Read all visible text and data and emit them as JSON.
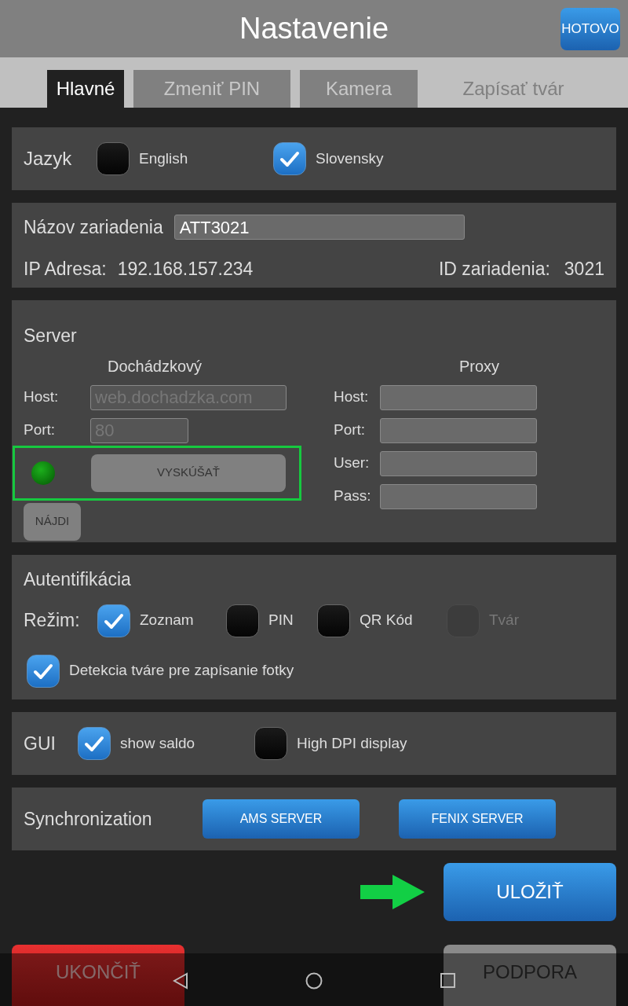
{
  "header": {
    "title": "Nastavenie",
    "done_button": "HOTOVO"
  },
  "tabs": [
    {
      "label": "Hlavné",
      "selected": true,
      "disabled": false
    },
    {
      "label": "Zmeniť PIN",
      "selected": false,
      "disabled": false
    },
    {
      "label": "Kamera",
      "selected": false,
      "disabled": false
    },
    {
      "label": "Zapísať tvár",
      "selected": false,
      "disabled": true
    }
  ],
  "language": {
    "label": "Jazyk",
    "options": [
      {
        "label": "English",
        "checked": false
      },
      {
        "label": "Slovensky",
        "checked": true
      }
    ]
  },
  "device": {
    "name_label": "Názov zariadenia",
    "name_value": "ATT3021",
    "ip_label": "IP Adresa:",
    "ip_value": "192.168.157.234",
    "id_label": "ID zariadenia:",
    "id_value": "3021"
  },
  "server": {
    "title": "Server",
    "attendance": {
      "heading": "Dochádzkový",
      "fields": [
        {
          "label": "Host:",
          "value": "web.dochadzka.com",
          "disabled": true
        },
        {
          "label": "Port:",
          "value": "80",
          "disabled": true
        }
      ],
      "status_on": true,
      "test_button": "VYSKÚŠAŤ",
      "find_button": "NÁJDI"
    },
    "proxy": {
      "heading": "Proxy",
      "fields": [
        {
          "label": "Host:"
        },
        {
          "label": "Port:"
        },
        {
          "label": "User:"
        },
        {
          "label": "Pass:"
        }
      ]
    }
  },
  "auth": {
    "title": "Autentifikácia",
    "mode_label": "Režim:",
    "modes": [
      {
        "label": "Zoznam",
        "checked": true,
        "disabled": false
      },
      {
        "label": "PIN",
        "checked": false,
        "disabled": false
      },
      {
        "label": "QR Kód",
        "checked": false,
        "disabled": false
      },
      {
        "label": "Tvár",
        "checked": false,
        "disabled": true
      }
    ],
    "face_detection": {
      "label": "Detekcia tváre pre zapísanie fotky",
      "checked": true
    }
  },
  "gui": {
    "label": "GUI",
    "options": [
      {
        "label": "show saldo",
        "checked": true
      },
      {
        "label": "High DPI display",
        "checked": false
      }
    ]
  },
  "sync": {
    "label": "Synchronization",
    "buttons": [
      "AMS SERVER",
      "FENIX SERVER"
    ]
  },
  "actions": {
    "save": "ULOŽIŤ",
    "quit": "UKONČIŤ",
    "support": "PODPORA"
  }
}
